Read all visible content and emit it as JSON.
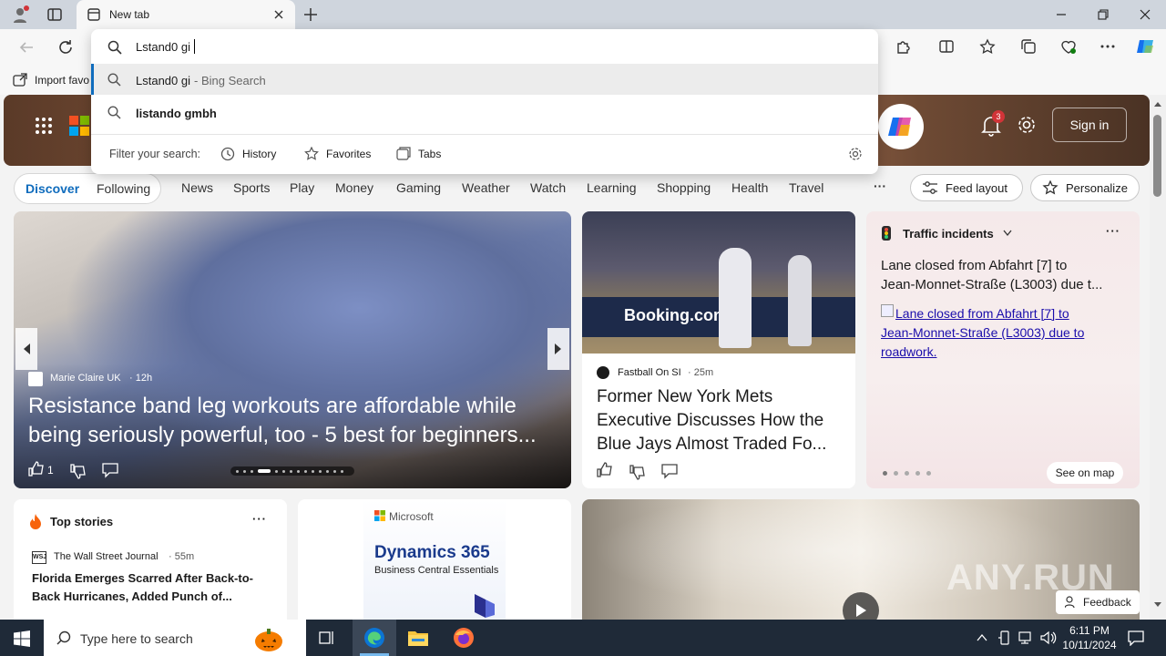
{
  "tab": {
    "title": "New tab"
  },
  "omnibox": {
    "query": "Lstand0 gi",
    "suggestions": [
      {
        "text": "Lstand0 gi",
        "suffix": " - Bing Search"
      },
      {
        "text": "listando gmbh",
        "suffix": ""
      }
    ],
    "filter_label": "Filter your search:",
    "filters": [
      "History",
      "Favorites",
      "Tabs"
    ]
  },
  "favbar": {
    "import_label": "Import favo"
  },
  "header": {
    "notif_count": "3",
    "sign_in": "Sign in"
  },
  "nav": {
    "discover": "Discover",
    "following": "Following",
    "items": [
      "News",
      "Sports",
      "Play",
      "Money",
      "Gaming",
      "Weather",
      "Watch",
      "Learning",
      "Shopping",
      "Health",
      "Travel"
    ],
    "more": "···",
    "feed_layout": "Feed layout",
    "personalize": "Personalize"
  },
  "hero_card": {
    "source": "Marie Claire UK",
    "age": "· 12h",
    "title_line1": "Resistance band leg workouts are affordable while",
    "title_line2": "being seriously powerful, too - 5 best for beginners...",
    "likes": "1"
  },
  "sports_card": {
    "source": "Fastball On SI",
    "age": "· 25m",
    "title_line1": "Former New York Mets",
    "title_line2": "Executive Discusses How the",
    "title_line3": "Blue Jays Almost Traded Fo...",
    "ad_text": "Booking.com"
  },
  "traffic_card": {
    "header": "Traffic incidents",
    "title_line1": "Lane closed from Abfahrt [7] to",
    "title_line2": "Jean-Monnet-Straße (L3003) due t...",
    "link_line1": "Lane closed from Abfahrt [7] to",
    "link_line2": "Jean-Monnet-Straße (L3003) due to",
    "link_line3": "roadwork.",
    "see_map": "See on map"
  },
  "top_stories": {
    "header": "Top stories",
    "source_logo": "WSJ",
    "source": "The Wall Street Journal",
    "age": "· 55m",
    "title_line1": "Florida Emerges Scarred After Back-to-",
    "title_line2": "Back Hurricanes, Added Punch of..."
  },
  "ad_card": {
    "brand": "Microsoft",
    "product": "Dynamics 365",
    "subtitle": "Business Central Essentials"
  },
  "video_card": {
    "watermark": "ANY.RUN",
    "feedback": "Feedback"
  },
  "taskbar": {
    "search_placeholder": "Type here to search",
    "time": "6:11 PM",
    "date": "10/11/2024"
  },
  "colors": {
    "accent": "#0f6cbd",
    "taskbar": "#1f2a38",
    "edge_blue": "#0078d4"
  }
}
